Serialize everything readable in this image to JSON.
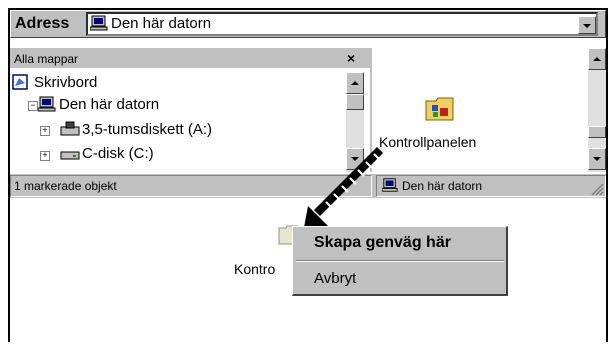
{
  "address_bar": {
    "label": "Adress",
    "value": "Den här datorn"
  },
  "folder_pane": {
    "title": "Alla mappar",
    "close_glyph": "×",
    "tree": [
      {
        "label": "Skrivbord",
        "icon": "desktop-icon"
      },
      {
        "label": "Den här datorn",
        "icon": "computer-icon",
        "expander": "−"
      },
      {
        "label": "3,5-tumsdiskett (A:)",
        "icon": "floppy-drive-icon",
        "expander": "+"
      },
      {
        "label": "C-disk (C:)",
        "icon": "hard-disk-icon",
        "expander": "+"
      }
    ]
  },
  "content_pane": {
    "item_label": "Kontrollpanelen",
    "item_icon": "control-panel-folder-icon"
  },
  "status_bar": {
    "selection_text": "1 markerade objekt",
    "location_text": "Den här datorn",
    "location_icon": "computer-icon"
  },
  "desktop": {
    "dropped_item_label": "Kontro",
    "drag_arrow_icon": "drag-arrow-icon"
  },
  "context_menu": {
    "items": [
      {
        "label": "Skapa genväg här",
        "default": true
      },
      {
        "label": "Avbryt",
        "default": false
      }
    ]
  },
  "colors": {
    "window_gray": "#c0c0c0",
    "shadow": "#808080",
    "highlight": "#ffffff",
    "icon_blue": "#000080",
    "folder_yellow": "#f0d060"
  }
}
